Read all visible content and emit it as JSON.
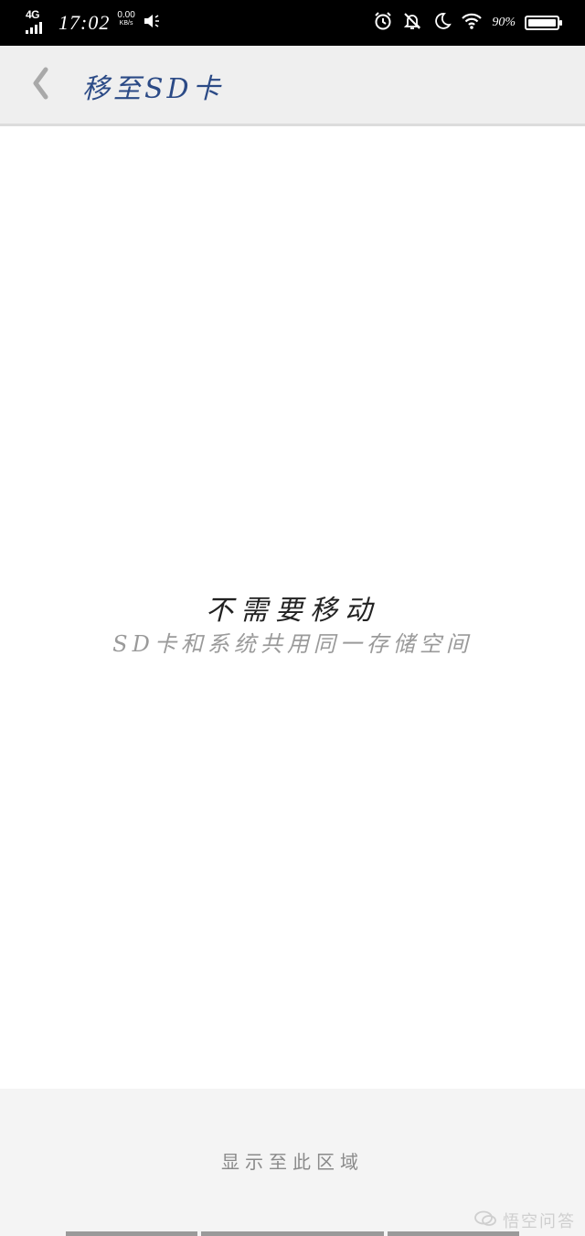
{
  "status_bar": {
    "network": "4G",
    "time": "17:02",
    "speed_value": "0.00",
    "speed_unit": "KB/s",
    "battery_percent": "90%"
  },
  "app_bar": {
    "title": "移至SD卡"
  },
  "content": {
    "message": "不需要移动",
    "description": "SD卡和系统共用同一存储空间"
  },
  "bottom": {
    "show_here_label": "显示至此区域"
  },
  "watermark": {
    "text": "悟空问答"
  }
}
